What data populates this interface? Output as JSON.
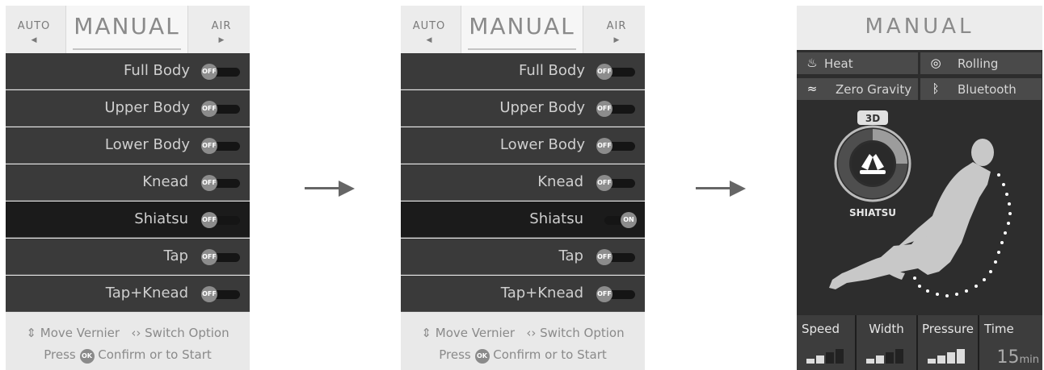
{
  "panels": [
    {
      "tabs": {
        "left": "AUTO",
        "main": "MANUAL",
        "right": "AIR"
      },
      "items": [
        {
          "label": "Full Body",
          "toggle": "OFF"
        },
        {
          "label": "Upper Body",
          "toggle": "OFF"
        },
        {
          "label": "Lower Body",
          "toggle": "OFF"
        },
        {
          "label": "Knead",
          "toggle": "OFF"
        },
        {
          "label": "Shiatsu",
          "toggle": "OFF"
        },
        {
          "label": "Tap",
          "toggle": "OFF"
        },
        {
          "label": "Tap+Knead",
          "toggle": "OFF"
        }
      ],
      "selected_index": 4,
      "footer": {
        "vernier": "Move Vernier",
        "switch": "Switch Option",
        "press": "Press",
        "ok": "OK",
        "confirm": "Confirm or to Start"
      }
    },
    {
      "tabs": {
        "left": "AUTO",
        "main": "MANUAL",
        "right": "AIR"
      },
      "items": [
        {
          "label": "Full Body",
          "toggle": "OFF"
        },
        {
          "label": "Upper Body",
          "toggle": "OFF"
        },
        {
          "label": "Lower Body",
          "toggle": "OFF"
        },
        {
          "label": "Knead",
          "toggle": "OFF"
        },
        {
          "label": "Shiatsu",
          "toggle": "ON"
        },
        {
          "label": "Tap",
          "toggle": "OFF"
        },
        {
          "label": "Tap+Knead",
          "toggle": "OFF"
        }
      ],
      "selected_index": 4,
      "footer": {
        "vernier": "Move Vernier",
        "switch": "Switch Option",
        "press": "Press",
        "ok": "OK",
        "confirm": "Confirm or to Start"
      }
    }
  ],
  "result": {
    "title": "MANUAL",
    "features": [
      {
        "label": "Heat",
        "icon": "flame-icon"
      },
      {
        "label": "Rolling",
        "icon": "roller-icon"
      },
      {
        "label": "Zero Gravity",
        "icon": "zero-gravity-icon"
      },
      {
        "label": "Bluetooth",
        "icon": "bluetooth-icon"
      }
    ],
    "badge": "3D",
    "mode": "SHIATSU",
    "stats": {
      "speed": "Speed",
      "width": "Width",
      "pressure": "Pressure",
      "time": "Time",
      "time_value": "15",
      "time_unit": "min"
    }
  },
  "colors": {
    "row_bg": "#3a3a3a",
    "row_selected": "#1b1b1b",
    "toggle_knob": "#8c8c8c",
    "accent_text": "#8a8a8a"
  }
}
